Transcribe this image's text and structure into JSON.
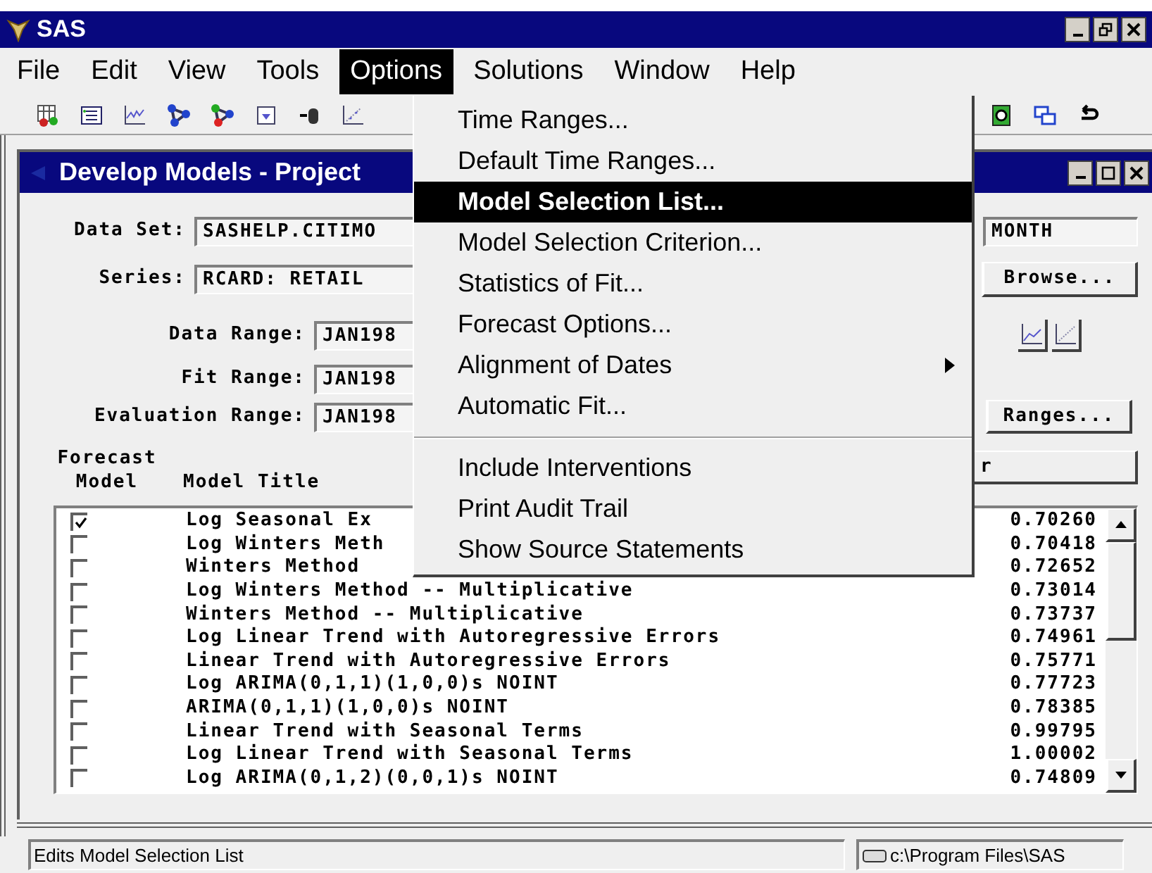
{
  "window": {
    "title": "SAS"
  },
  "menu_bar": [
    {
      "label": "File",
      "selected": false
    },
    {
      "label": "Edit",
      "selected": false
    },
    {
      "label": "View",
      "selected": false
    },
    {
      "label": "Tools",
      "selected": false
    },
    {
      "label": "Options",
      "selected": true
    },
    {
      "label": "Solutions",
      "selected": false
    },
    {
      "label": "Window",
      "selected": false
    },
    {
      "label": "Help",
      "selected": false
    }
  ],
  "options_menu": [
    {
      "kind": "item",
      "label": "Time Ranges...",
      "selected": false,
      "submenu": false
    },
    {
      "kind": "item",
      "label": "Default Time Ranges...",
      "selected": false,
      "submenu": false
    },
    {
      "kind": "item",
      "label": "Model Selection List...",
      "selected": true,
      "submenu": false
    },
    {
      "kind": "item",
      "label": "Model Selection Criterion...",
      "selected": false,
      "submenu": false
    },
    {
      "kind": "item",
      "label": "Statistics of Fit...",
      "selected": false,
      "submenu": false
    },
    {
      "kind": "item",
      "label": "Forecast Options...",
      "selected": false,
      "submenu": false
    },
    {
      "kind": "item",
      "label": "Alignment of Dates",
      "selected": false,
      "submenu": true
    },
    {
      "kind": "item",
      "label": "Automatic Fit...",
      "selected": false,
      "submenu": false
    },
    {
      "kind": "separator"
    },
    {
      "kind": "item",
      "label": "Include Interventions",
      "selected": false,
      "submenu": false
    },
    {
      "kind": "item",
      "label": "Print Audit Trail",
      "selected": false,
      "submenu": false
    },
    {
      "kind": "item",
      "label": "Show Source Statements",
      "selected": false,
      "submenu": false
    }
  ],
  "develop_models": {
    "title": "Develop Models - Project",
    "data_set": {
      "label": "Data Set:",
      "value": "SASHELP.CITIMO"
    },
    "interval": {
      "value": "MONTH"
    },
    "series": {
      "label": "Series:",
      "value": "RCARD: RETAIL"
    },
    "browse_button": "Browse...",
    "data_range": {
      "label": "Data Range:",
      "value": "JAN198"
    },
    "fit_range": {
      "label": "Fit Range:",
      "value": "JAN198"
    },
    "evaluation_range": {
      "label": "Evaluation Range:",
      "value": "JAN198"
    },
    "ranges_button": "Ranges...",
    "column_button": "r",
    "columns": [
      "Forecast Model",
      "Model Title"
    ],
    "rows": [
      {
        "checked": true,
        "title": "Log Seasonal Ex",
        "value": "0.70260"
      },
      {
        "checked": false,
        "title": "Log Winters Meth",
        "value": "0.70418"
      },
      {
        "checked": false,
        "title": "Winters Method",
        "value": "0.72652"
      },
      {
        "checked": false,
        "title": "Log Winters Method -- Multiplicative",
        "value": "0.73014"
      },
      {
        "checked": false,
        "title": "Winters Method -- Multiplicative",
        "value": "0.73737"
      },
      {
        "checked": false,
        "title": "Log Linear Trend with Autoregressive Errors",
        "value": "0.74961"
      },
      {
        "checked": false,
        "title": "Linear Trend with Autoregressive Errors",
        "value": "0.75771"
      },
      {
        "checked": false,
        "title": "Log ARIMA(0,1,1)(1,0,0)s NOINT",
        "value": "0.77723"
      },
      {
        "checked": false,
        "title": "ARIMA(0,1,1)(1,0,0)s NOINT",
        "value": "0.78385"
      },
      {
        "checked": false,
        "title": "Linear Trend with Seasonal Terms",
        "value": "0.99795"
      },
      {
        "checked": false,
        "title": "Log Linear Trend with Seasonal Terms",
        "value": "1.00002"
      },
      {
        "checked": false,
        "title": "Log ARIMA(0,1,2)(0,0,1)s NOINT",
        "value": "0.74809"
      }
    ]
  },
  "status_bar": {
    "message": "Edits Model Selection List",
    "path": "c:\\Program Files\\SAS"
  }
}
